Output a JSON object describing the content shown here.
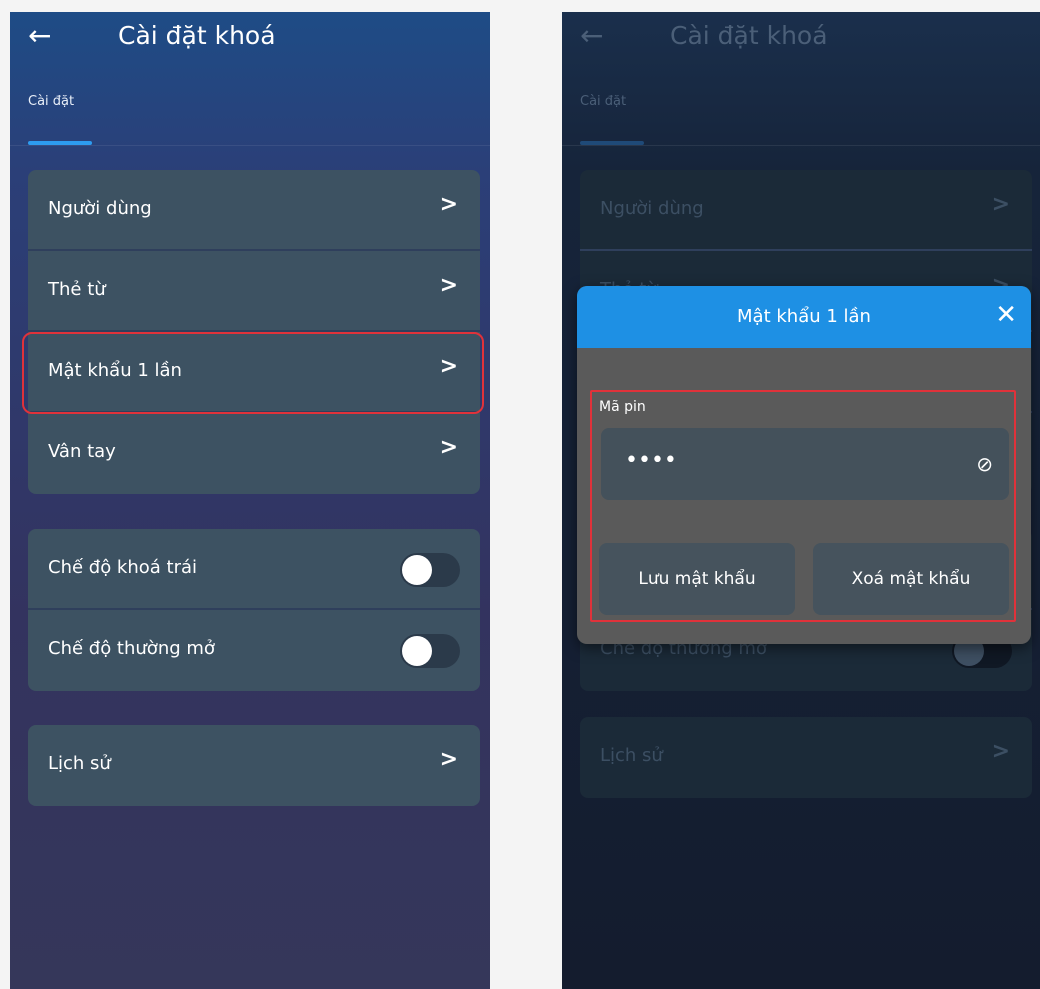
{
  "screen": {
    "title": "Cài đặt khoá",
    "tab": "Cài đặt",
    "menu": [
      "Người dùng",
      "Thẻ từ",
      "Mật khẩu 1 lần",
      "Vân tay"
    ],
    "toggles": [
      "Chế độ khoá trái",
      "Chế độ thường mở"
    ],
    "history": "Lịch sử"
  },
  "icons": {
    "back": "back-arrow-icon",
    "chevron": "chevron-right-icon",
    "close": "close-icon",
    "eye": "eye-slash-icon"
  },
  "glyphs": {
    "back": "←",
    "chevron": ">",
    "close": "✕",
    "eye": "⊘"
  },
  "dialog": {
    "title": "Mật khẩu 1 lần",
    "pin_label": "Mã pin",
    "pin_value": "••••",
    "save_label": "Lưu mật khẩu",
    "delete_label": "Xoá mật khẩu"
  },
  "colors": {
    "accent": "#1e90e4",
    "highlight": "#e0323a",
    "tab_indicator": "#2d9cf0"
  },
  "toggle_state": {
    "lock_mode": false,
    "normally_open": false
  }
}
